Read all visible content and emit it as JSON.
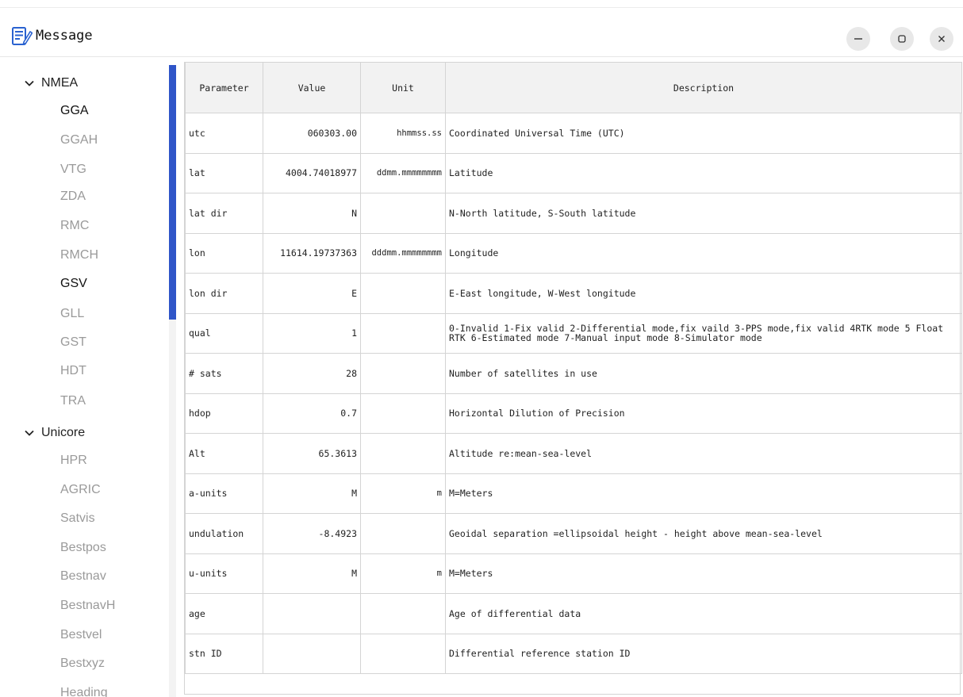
{
  "window": {
    "title": "Message",
    "controls": {
      "minimize": "−",
      "maximize": "▢",
      "close": "×"
    }
  },
  "sidebar": {
    "groups": [
      {
        "label": "NMEA",
        "items": [
          {
            "label": "GGA",
            "active": true
          },
          {
            "label": "GGAH",
            "active": false
          },
          {
            "label": "VTG",
            "active": false
          },
          {
            "label": "ZDA",
            "active": false
          },
          {
            "label": "RMC",
            "active": false
          },
          {
            "label": "RMCH",
            "active": false
          },
          {
            "label": "GSV",
            "active": true
          },
          {
            "label": "GLL",
            "active": false
          },
          {
            "label": "GST",
            "active": false
          },
          {
            "label": "HDT",
            "active": false
          },
          {
            "label": "TRA",
            "active": false
          }
        ]
      },
      {
        "label": "Unicore",
        "items": [
          {
            "label": "HPR",
            "active": false
          },
          {
            "label": "AGRIC",
            "active": false
          },
          {
            "label": "Satvis",
            "active": false
          },
          {
            "label": "Bestpos",
            "active": false
          },
          {
            "label": "Bestnav",
            "active": false
          },
          {
            "label": "BestnavH",
            "active": false
          },
          {
            "label": "Bestvel",
            "active": false
          },
          {
            "label": "Bestxyz",
            "active": false
          },
          {
            "label": "Heading",
            "active": false
          }
        ]
      }
    ]
  },
  "table": {
    "headers": [
      "Parameter",
      "Value",
      "Unit",
      "Description"
    ],
    "rows": [
      [
        "utc",
        "060303.00",
        "hhmmss.ss",
        "Coordinated Universal Time (UTC)"
      ],
      [
        "lat",
        "4004.74018977",
        "ddmm.mmmmmmmm",
        "Latitude"
      ],
      [
        "lat dir",
        "N",
        "",
        "N-North latitude, S-South latitude"
      ],
      [
        "lon",
        "11614.19737363",
        "dddmm.mmmmmmmm",
        "Longitude"
      ],
      [
        "lon dir",
        "E",
        "",
        "E-East longitude, W-West longitude"
      ],
      [
        "qual",
        "1",
        "",
        "0-Invalid 1-Fix valid 2-Differential mode,fix vaild 3-PPS mode,fix valid 4RTK mode 5 Float RTK 6-Estimated mode 7-Manual  input mode 8-Simulator mode"
      ],
      [
        "# sats",
        "28",
        "",
        "Number of satellites in use"
      ],
      [
        "hdop",
        "0.7",
        "",
        "Horizontal Dilution of Precision"
      ],
      [
        "Alt",
        "65.3613",
        "",
        "Altitude re:mean-sea-level"
      ],
      [
        "a-units",
        "M",
        "m",
        "M=Meters"
      ],
      [
        "undulation",
        "-8.4923",
        "",
        "Geoidal separation =ellipsoidal height - height above mean-sea-level"
      ],
      [
        "u-units",
        "M",
        "m",
        "M=Meters"
      ],
      [
        "age",
        "",
        "",
        "Age of differential data"
      ],
      [
        "stn ID",
        "",
        "",
        "Differential reference station ID"
      ]
    ]
  }
}
